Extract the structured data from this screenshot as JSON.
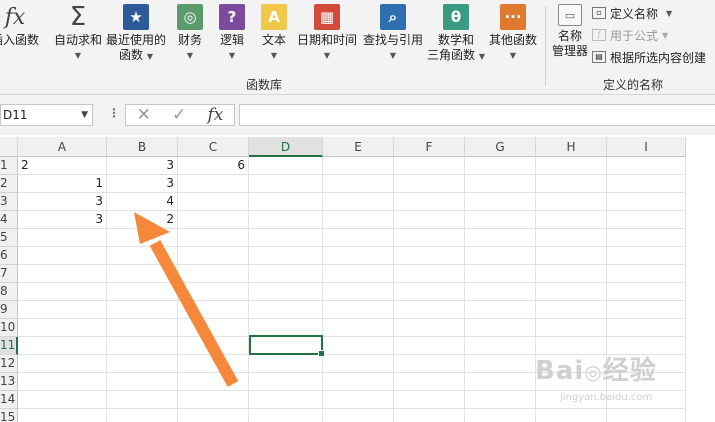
{
  "ribbon": {
    "buttons": [
      {
        "label": "插入函数",
        "icon": "fx-icon",
        "color": "#444444"
      },
      {
        "label": "自动求和",
        "icon": "sigma-icon",
        "color": "#444444",
        "dropdown": true
      },
      {
        "label": "最近使用的",
        "label2": "函数",
        "icon": "star-book-icon",
        "color": "#2e5a9c",
        "dropdown": true
      },
      {
        "label": "财务",
        "icon": "coins-book-icon",
        "color": "#5b9b6b",
        "dropdown": true
      },
      {
        "label": "逻辑",
        "icon": "question-book-icon",
        "color": "#7d4b9e",
        "dropdown": true
      },
      {
        "label": "文本",
        "icon": "text-book-icon",
        "color": "#e8b020",
        "dropdown": true
      },
      {
        "label": "日期和时间",
        "icon": "calendar-book-icon",
        "color": "#d24b3a",
        "dropdown": true
      },
      {
        "label": "查找与引用",
        "icon": "magnifier-book-icon",
        "color": "#2e6fb0",
        "dropdown": true
      },
      {
        "label": "数学和",
        "label2": "三角函数",
        "icon": "theta-book-icon",
        "color": "#3a9a82",
        "dropdown": true
      },
      {
        "label": "其他函数",
        "icon": "more-book-icon",
        "color": "#e07a30",
        "dropdown": true
      }
    ],
    "library_group_label": "函数库",
    "name_manager": {
      "label": "名称",
      "label2": "管理器"
    },
    "define_name": "定义名称",
    "use_in_formula": "用于公式",
    "create_from_selection": "根据所选内容创建",
    "defined_names_group_label": "定义的名称"
  },
  "formula_bar": {
    "name_box": "D11",
    "cancel_symbol": "✕",
    "enter_symbol": "✓",
    "fx_symbol": "fx",
    "content": ""
  },
  "sheet": {
    "columns": [
      "A",
      "B",
      "C",
      "D",
      "E",
      "F",
      "G",
      "H",
      "I"
    ],
    "selected_column": "D",
    "rows": [
      "1",
      "2",
      "3",
      "4",
      "5",
      "6",
      "7",
      "8",
      "9",
      "10",
      "11",
      "12",
      "13",
      "14",
      "15"
    ],
    "selected_row": "11",
    "cells": {
      "r1": {
        "A": "2",
        "B": "3",
        "C": "6"
      },
      "r2": {
        "A": "1",
        "B": "3"
      },
      "r3": {
        "A": "3",
        "B": "4"
      },
      "r4": {
        "A": "3",
        "B": "2"
      }
    }
  },
  "annotation_arrow_color": "#f5883a",
  "watermark": {
    "text": "Bai 经验",
    "url": "jingyan.baidu.com"
  }
}
